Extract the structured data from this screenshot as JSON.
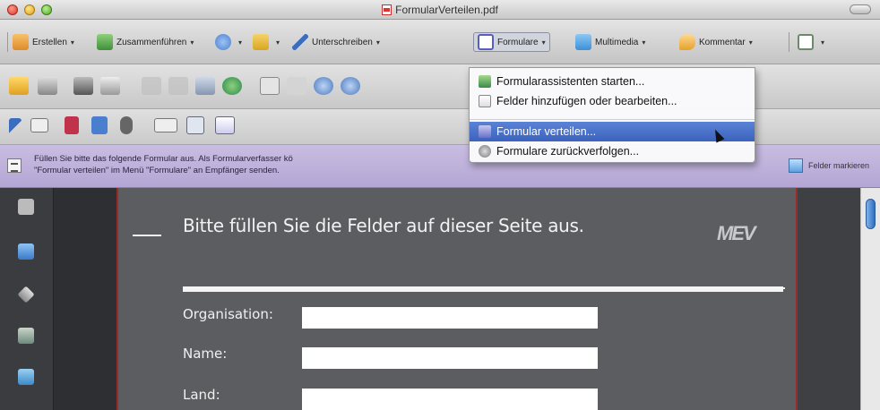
{
  "window": {
    "title": "FormularVerteilen.pdf"
  },
  "toolbar": {
    "items": [
      {
        "label": "Erstellen",
        "icon": "create-icon",
        "color": "#e08a2a"
      },
      {
        "label": "Zusammenführen",
        "icon": "combine-icon",
        "color": "#3f8f3a"
      },
      {
        "label": "",
        "icon": "share-icon",
        "color": "#4a7fd0"
      },
      {
        "label": "",
        "icon": "secure-icon",
        "color": "#d9a520"
      },
      {
        "label": "Unterschreiben",
        "icon": "sign-icon",
        "color": "#3a6cc0"
      },
      {
        "label": "Formulare",
        "icon": "forms-icon",
        "color": "#5a5fb8"
      },
      {
        "label": "Multimedia",
        "icon": "multimedia-icon",
        "color": "#3d8fd8"
      },
      {
        "label": "Kommentar",
        "icon": "comment-icon",
        "color": "#e6a12b"
      },
      {
        "label": "",
        "icon": "view-icon",
        "color": "#6a8a6a"
      }
    ]
  },
  "forms_menu": {
    "items": [
      {
        "label": "Formularassistenten starten...",
        "icon": "form-wizard-icon"
      },
      {
        "label": "Felder hinzufügen oder bearbeiten...",
        "icon": "edit-fields-icon"
      },
      {
        "label": "Formular verteilen...",
        "icon": "distribute-form-icon"
      },
      {
        "label": "Formulare zurückverfolgen...",
        "icon": "track-forms-icon"
      }
    ],
    "highlighted_index": 2
  },
  "infobar": {
    "line1": "Füllen Sie bitte das folgende Formular aus. Als Formularverfasser kö",
    "line2": "\"Formular verteilen\" im Menü \"Formulare\" an Empfänger senden.",
    "button": "Felder markieren"
  },
  "document": {
    "heading": "Bitte füllen Sie die Felder auf dieser Seite aus.",
    "logo": "MEV",
    "fields": [
      {
        "label": "Organisation:",
        "value": ""
      },
      {
        "label": "Name:",
        "value": ""
      },
      {
        "label": "Land:",
        "value": ""
      }
    ]
  },
  "colors": {
    "accent_highlight": "#3b63bd",
    "infobar": "#b4a6d4",
    "page_border": "#9a2b2b"
  }
}
